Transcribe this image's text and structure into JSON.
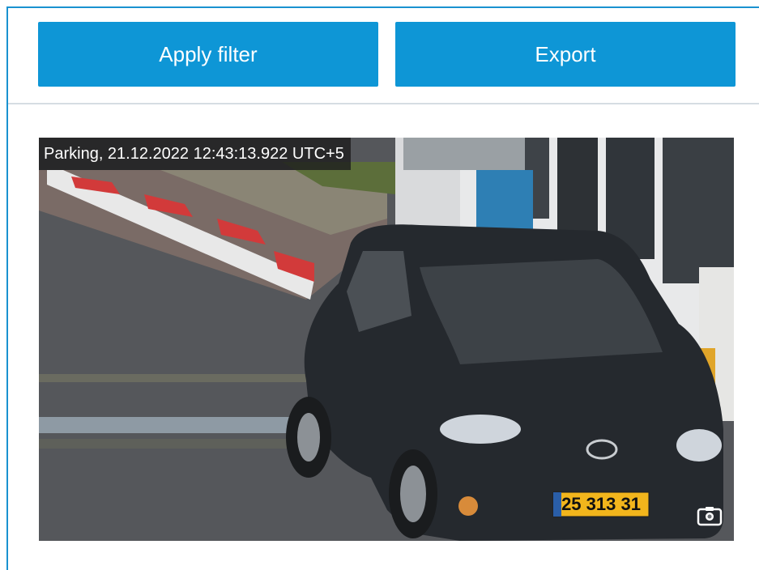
{
  "toolbar": {
    "apply_label": "Apply filter",
    "export_label": "Export"
  },
  "snapshot": {
    "caption": "Parking, 21.12.2022 12:43:13.922 UTC+5",
    "plate_number": "25 313 31",
    "camera_icon": "camera-icon"
  },
  "colors": {
    "accent": "#0e96d6",
    "frame": "#1a92d0",
    "plate_yellow": "#f2b51c"
  }
}
